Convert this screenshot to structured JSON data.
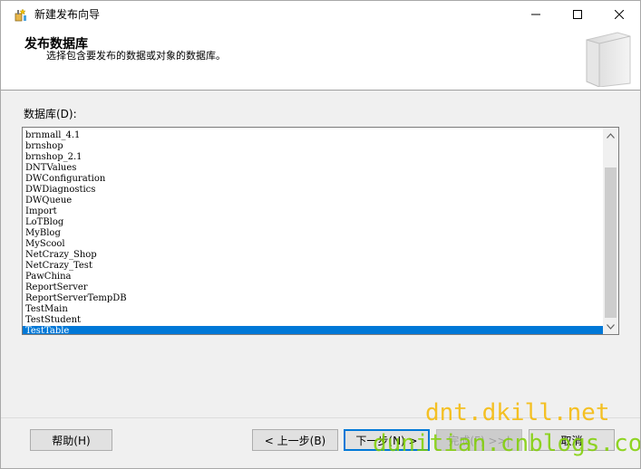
{
  "window": {
    "title": "新建发布向导",
    "controls": {
      "minimize_icon": "minimize-icon",
      "maximize_icon": "maximize-icon",
      "close_icon": "close-icon"
    }
  },
  "header": {
    "title": "发布数据库",
    "description": "选择包含要发布的数据或对象的数据库。"
  },
  "database_list": {
    "label": "数据库(D):",
    "items": [
      "brnmall_4.1",
      "brnshop",
      "brnshop_2.1",
      "DNTValues",
      "DWConfiguration",
      "DWDiagnostics",
      "DWQueue",
      "Import",
      "LoTBlog",
      "MyBlog",
      "MyScool",
      "NetCrazy_Shop",
      "NetCrazy_Test",
      "PawChina",
      "ReportServer",
      "ReportServerTempDB",
      "TestMain",
      "TestStudent",
      "TestTable"
    ],
    "selected": "TestTable"
  },
  "buttons": {
    "help": "帮助(H)",
    "previous": "< 上一步(B)",
    "next": "下一步(N) >",
    "finish": "完成(F) >>|",
    "cancel": "取消"
  },
  "watermarks": {
    "line1": "dnt.dkill.net",
    "line2": "dunitian.cnblogs.com"
  },
  "colors": {
    "selection": "#0078d7",
    "default_button_border": "#0078d7",
    "watermark1": "#f5b800",
    "watermark2": "#7fd000"
  }
}
